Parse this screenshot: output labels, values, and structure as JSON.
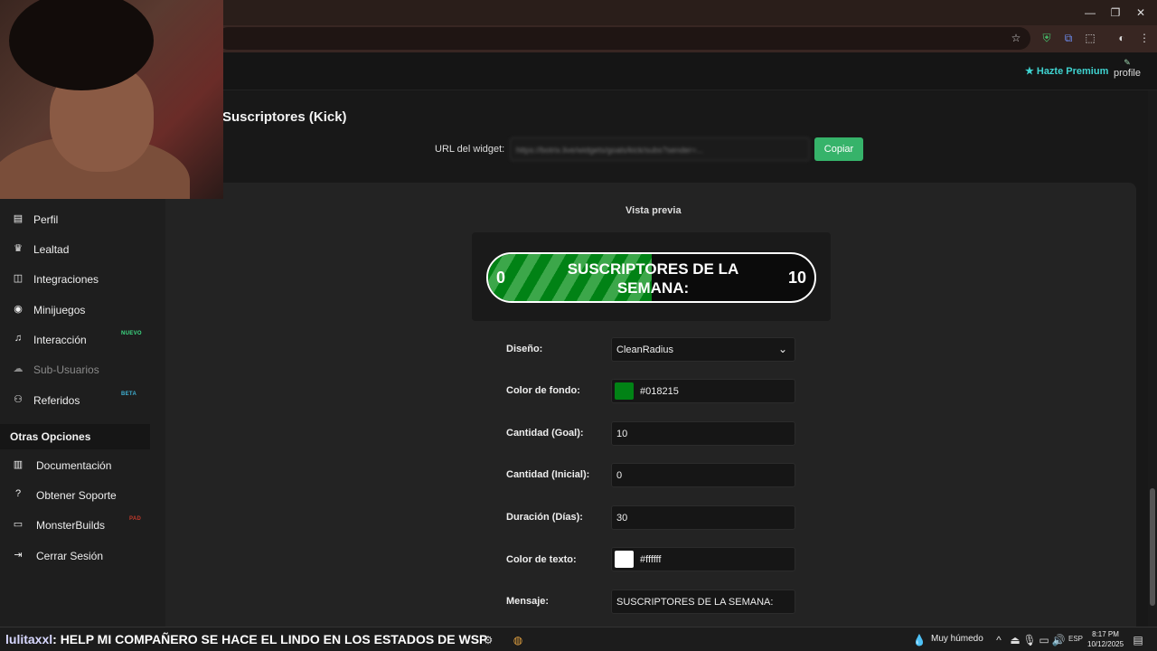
{
  "browser": {
    "window_controls": [
      "—",
      "❐",
      "✕"
    ],
    "toolbar_icons": [
      "star-icon",
      "shield-extension-icon",
      "translate-icon",
      "extensions-icon",
      "profile-icon",
      "menu-icon"
    ]
  },
  "header": {
    "premium_label": "Hazte Premium",
    "profile_label": "profile"
  },
  "page": {
    "title": "Suscriptores (Kick)",
    "url_label": "URL del widget:",
    "url_value": "https://botrix.live/widgets/goals/kick/subs?sender=...",
    "copy_label": "Copiar"
  },
  "sidebar": {
    "items": [
      {
        "label": "Perfil",
        "icon": "id-card-icon",
        "glyph": "▤"
      },
      {
        "label": "Lealtad",
        "icon": "trophy-icon",
        "glyph": "♛"
      },
      {
        "label": "Integraciones",
        "icon": "integrations-icon",
        "glyph": "◫"
      },
      {
        "label": "Minijuegos",
        "icon": "gamepad-icon",
        "glyph": "◉"
      },
      {
        "label": "Interacción",
        "icon": "music-icon",
        "glyph": "♫",
        "badge": "NUEVO",
        "badge_color": "#3ddc84"
      },
      {
        "label": "Sub-Usuarios",
        "icon": "users-cog-icon",
        "glyph": "☁",
        "disabled": true
      },
      {
        "label": "Referidos",
        "icon": "users-icon",
        "glyph": "⚇",
        "badge": "BETA",
        "badge_color": "#3fb0d3"
      }
    ],
    "section_title": "Otras Opciones",
    "options": [
      {
        "label": "Documentación",
        "icon": "book-icon",
        "glyph": "▥"
      },
      {
        "label": "Obtener Soporte",
        "icon": "question-icon",
        "glyph": "?"
      },
      {
        "label": "MonsterBuilds",
        "icon": "laptop-icon",
        "glyph": "▭",
        "badge": "PAD",
        "badge_color": "#c0392b"
      },
      {
        "label": "Cerrar Sesión",
        "icon": "logout-icon",
        "glyph": "⇥"
      }
    ]
  },
  "preview": {
    "label": "Vista previa",
    "min": "0",
    "max": "10",
    "text": "SUSCRIPTORES DE LA SEMANA:",
    "progress": 0.5
  },
  "form": {
    "design_label": "Diseño:",
    "design_value": "CleanRadius",
    "bg_color_label": "Color de fondo:",
    "bg_color_value": "#018215",
    "goal_label": "Cantidad (Goal):",
    "goal_value": "10",
    "initial_label": "Cantidad (Inicial):",
    "initial_value": "0",
    "duration_label": "Duración (Días):",
    "duration_value": "30",
    "text_color_label": "Color de texto:",
    "text_color_value": "#ffffff",
    "message_label": "Mensaje:",
    "message_value": "SUSCRIPTORES DE LA SEMANA:"
  },
  "overlay": {
    "chat_user": "lulitaxxl",
    "chat_message": ": HELP MI COMPAÑERO SE HACE EL LINDO EN LOS ESTADOS DE WSP"
  },
  "taskbar": {
    "weather": "Muy húmedo",
    "language": "ESP",
    "time": "8:17 PM",
    "date": "10/12/2025"
  }
}
